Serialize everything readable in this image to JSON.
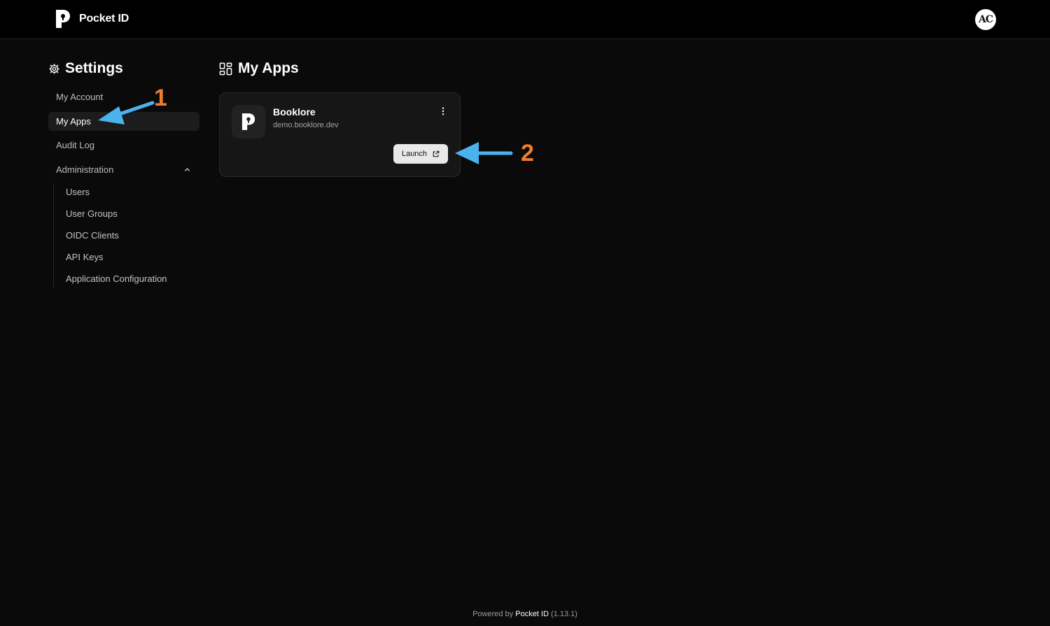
{
  "header": {
    "brand": "Pocket ID",
    "avatar_initials": "AC"
  },
  "sidebar": {
    "title": "Settings",
    "items": [
      {
        "label": "My Account"
      },
      {
        "label": "My Apps",
        "active": true
      },
      {
        "label": "Audit Log"
      },
      {
        "label": "Administration",
        "expanded": true
      }
    ],
    "admin_items": [
      {
        "label": "Users"
      },
      {
        "label": "User Groups"
      },
      {
        "label": "OIDC Clients"
      },
      {
        "label": "API Keys"
      },
      {
        "label": "Application Configuration"
      }
    ]
  },
  "main": {
    "title": "My Apps",
    "apps": [
      {
        "name": "Booklore",
        "url": "demo.booklore.dev",
        "launch_label": "Launch"
      }
    ]
  },
  "annotations": {
    "label_1": "1",
    "label_2": "2",
    "arrow_color": "#4ab3ee",
    "number_color": "#ef7d2f"
  },
  "footer": {
    "prefix": "Powered by",
    "product": "Pocket ID",
    "version": "(1.13.1)"
  }
}
